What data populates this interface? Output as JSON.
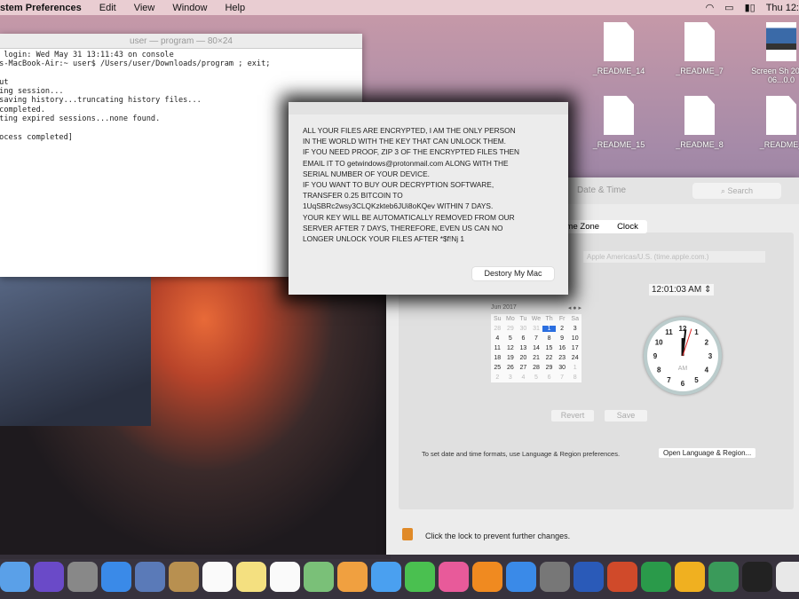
{
  "menubar": {
    "app": "stem Preferences",
    "items": [
      "Edit",
      "View",
      "Window",
      "Help"
    ],
    "clock": "Thu 12:",
    "status_icons": [
      "wifi-icon",
      "airplay-icon",
      "battery-icon"
    ]
  },
  "desktop": {
    "icons": [
      {
        "label": "_README_14",
        "type": "document"
      },
      {
        "label": "_README_7",
        "type": "document"
      },
      {
        "label": "Screen Sh 2017-06...0.0",
        "type": "image"
      },
      {
        "label": "_README_15",
        "type": "document"
      },
      {
        "label": "_README_8",
        "type": "document"
      },
      {
        "label": "_README_",
        "type": "document"
      }
    ]
  },
  "terminal": {
    "title": "user — program — 80×24",
    "lines": "t login: Wed May 31 13:11:43 on console\nrs-MacBook-Air:~ user$ /Users/user/Downloads/program ; exit;\ne\nout\nving session...\n saving history...truncating history files...\n completed.\neting expired sessions...none found.\n\nrocess completed]"
  },
  "ransom_dialog": {
    "message": "ALL YOUR FILES ARE ENCRYPTED, I AM THE ONLY PERSON\nIN THE WORLD WITH THE KEY THAT CAN UNLOCK THEM.\nIF YOU NEED PROOF, ZIP 3 OF THE ENCRYPTED FILES THEN\nEMAIL IT TO getwindows@protonmail.com ALONG WITH THE\nSERIAL NUMBER OF YOUR DEVICE.\nIF YOU WANT TO BUY OUR DECRYPTION SOFTWARE,\nTRANSFER 0.25 BITCOIN TO\n1UqSBRc2wsy3CLQKzkteb6JUi8oKQev WITHIN 7 DAYS.\nYOUR KEY WILL BE AUTOMATICALLY REMOVED FROM OUR\nSERVER AFTER 7 DAYS, THEREFORE, EVEN US CAN NO\nLONGER UNLOCK YOUR FILES AFTER  *$f!Nj 1",
    "button": "Destory My Mac"
  },
  "prefs": {
    "title": "Date & Time",
    "search_placeholder": "Search",
    "tabs": [
      "Time Zone",
      "Clock"
    ],
    "server": "Apple Americas/U.S. (time.apple.com.)",
    "time": "12:01:03 AM",
    "calendar": {
      "month": "Jun 2017",
      "weekdays": [
        "Su",
        "Mo",
        "Tu",
        "We",
        "Th",
        "Fr",
        "Sa"
      ],
      "days": [
        "28",
        "29",
        "30",
        "31",
        "1",
        "2",
        "3",
        "4",
        "5",
        "6",
        "7",
        "8",
        "9",
        "10",
        "11",
        "12",
        "13",
        "14",
        "15",
        "16",
        "17",
        "18",
        "19",
        "20",
        "21",
        "22",
        "23",
        "24",
        "25",
        "26",
        "27",
        "28",
        "29",
        "30",
        "1",
        "2",
        "3",
        "4",
        "5",
        "6",
        "7",
        "8"
      ],
      "selected": "1"
    },
    "clock_label": "AM",
    "clock_time": {
      "hour": 12,
      "minute": 1,
      "second": 3
    },
    "revert": "Revert",
    "save": "Save",
    "note": "To set date and time formats, use Language & Region preferences.",
    "open_lr": "Open Language & Region...",
    "lock_text": "Click the lock to prevent further changes."
  },
  "dock": [
    {
      "name": "finder",
      "color": "#5aa0e8"
    },
    {
      "name": "siri",
      "color": "#6a4ac8"
    },
    {
      "name": "launchpad",
      "color": "#888"
    },
    {
      "name": "safari",
      "color": "#3a8ae8"
    },
    {
      "name": "preview",
      "color": "#5a7ab8"
    },
    {
      "name": "contacts",
      "color": "#b89050"
    },
    {
      "name": "calendar",
      "color": "#fafafa"
    },
    {
      "name": "notes",
      "color": "#f4e080"
    },
    {
      "name": "reminders",
      "color": "#fafafa"
    },
    {
      "name": "maps",
      "color": "#7ac078"
    },
    {
      "name": "photos",
      "color": "#f0a040"
    },
    {
      "name": "messages",
      "color": "#4aa0f0"
    },
    {
      "name": "facetime",
      "color": "#4ac050"
    },
    {
      "name": "itunes",
      "color": "#e85a9a"
    },
    {
      "name": "ibooks",
      "color": "#f08a20"
    },
    {
      "name": "app-store",
      "color": "#3a8ae8"
    },
    {
      "name": "system-preferences",
      "color": "#777"
    },
    {
      "name": "word",
      "color": "#2a5ab8"
    },
    {
      "name": "powerpoint",
      "color": "#d04a2a"
    },
    {
      "name": "excel",
      "color": "#2a9a4a"
    },
    {
      "name": "outlook",
      "color": "#f0b020"
    },
    {
      "name": "globe-app",
      "color": "#3a9a5a"
    },
    {
      "name": "terminal",
      "color": "#222"
    },
    {
      "name": "trash",
      "color": "#e8e8e8"
    }
  ]
}
